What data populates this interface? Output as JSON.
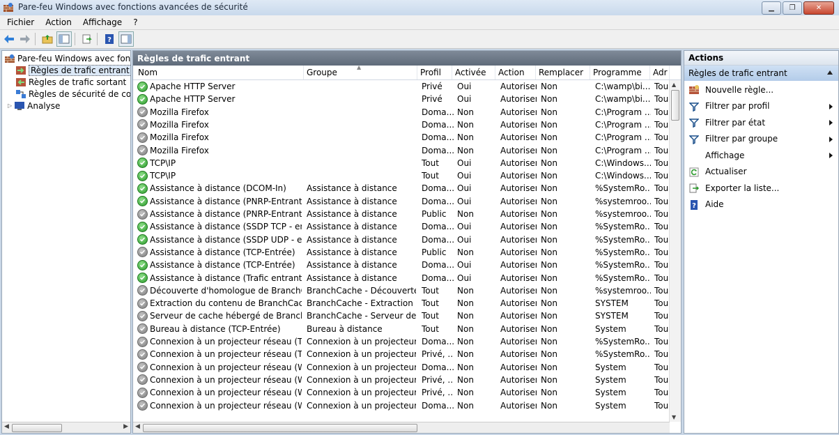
{
  "window": {
    "title": "Pare-feu Windows avec fonctions avancées de sécurité"
  },
  "menu": [
    "Fichier",
    "Action",
    "Affichage",
    "?"
  ],
  "tree": {
    "root": "Pare-feu Windows avec fonctio",
    "items": [
      "Règles de trafic entrant",
      "Règles de trafic sortant",
      "Règles de sécurité de conne",
      "Analyse"
    ]
  },
  "center": {
    "header": "Règles de trafic entrant",
    "columns": [
      "Nom",
      "Groupe",
      "Profil",
      "Activée",
      "Action",
      "Remplacer",
      "Programme",
      "Adr"
    ],
    "rows": [
      {
        "on": true,
        "nom": "Apache HTTP Server",
        "groupe": "",
        "profil": "Privé",
        "activee": "Oui",
        "action": "Autoriser",
        "remplacer": "Non",
        "programme": "C:\\wamp\\bi...",
        "adr": "Tou"
      },
      {
        "on": true,
        "nom": "Apache HTTP Server",
        "groupe": "",
        "profil": "Privé",
        "activee": "Oui",
        "action": "Autoriser",
        "remplacer": "Non",
        "programme": "C:\\wamp\\bi...",
        "adr": "Tou"
      },
      {
        "on": false,
        "nom": "Mozilla Firefox",
        "groupe": "",
        "profil": "Doma...",
        "activee": "Non",
        "action": "Autoriser",
        "remplacer": "Non",
        "programme": "C:\\Program ...",
        "adr": "Tou"
      },
      {
        "on": false,
        "nom": "Mozilla Firefox",
        "groupe": "",
        "profil": "Doma...",
        "activee": "Non",
        "action": "Autoriser",
        "remplacer": "Non",
        "programme": "C:\\Program ...",
        "adr": "Tou"
      },
      {
        "on": false,
        "nom": "Mozilla Firefox",
        "groupe": "",
        "profil": "Doma...",
        "activee": "Non",
        "action": "Autoriser",
        "remplacer": "Non",
        "programme": "C:\\Program ...",
        "adr": "Tou"
      },
      {
        "on": false,
        "nom": "Mozilla Firefox",
        "groupe": "",
        "profil": "Doma...",
        "activee": "Non",
        "action": "Autoriser",
        "remplacer": "Non",
        "programme": "C:\\Program ...",
        "adr": "Tou"
      },
      {
        "on": true,
        "nom": "TCP\\IP",
        "groupe": "",
        "profil": "Tout",
        "activee": "Oui",
        "action": "Autoriser",
        "remplacer": "Non",
        "programme": "C:\\Windows...",
        "adr": "Tou"
      },
      {
        "on": true,
        "nom": "TCP\\IP",
        "groupe": "",
        "profil": "Tout",
        "activee": "Oui",
        "action": "Autoriser",
        "remplacer": "Non",
        "programme": "C:\\Windows...",
        "adr": "Tou"
      },
      {
        "on": true,
        "nom": "Assistance à distance (DCOM-In)",
        "groupe": "Assistance à distance",
        "profil": "Doma...",
        "activee": "Oui",
        "action": "Autoriser",
        "remplacer": "Non",
        "programme": "%SystemRo...",
        "adr": "Tou"
      },
      {
        "on": true,
        "nom": "Assistance à distance (PNRP-Entrant)",
        "groupe": "Assistance à distance",
        "profil": "Doma...",
        "activee": "Oui",
        "action": "Autoriser",
        "remplacer": "Non",
        "programme": "%systemroo...",
        "adr": "Tou"
      },
      {
        "on": false,
        "nom": "Assistance à distance (PNRP-Entrant)",
        "groupe": "Assistance à distance",
        "profil": "Public",
        "activee": "Non",
        "action": "Autoriser",
        "remplacer": "Non",
        "programme": "%systemroo...",
        "adr": "Tou"
      },
      {
        "on": true,
        "nom": "Assistance à distance (SSDP TCP - en ent...",
        "groupe": "Assistance à distance",
        "profil": "Doma...",
        "activee": "Oui",
        "action": "Autoriser",
        "remplacer": "Non",
        "programme": "%SystemRo...",
        "adr": "Tou"
      },
      {
        "on": true,
        "nom": "Assistance à distance (SSDP UDP - en ent...",
        "groupe": "Assistance à distance",
        "profil": "Doma...",
        "activee": "Oui",
        "action": "Autoriser",
        "remplacer": "Non",
        "programme": "%SystemRo...",
        "adr": "Tou"
      },
      {
        "on": false,
        "nom": "Assistance à distance (TCP-Entrée)",
        "groupe": "Assistance à distance",
        "profil": "Public",
        "activee": "Non",
        "action": "Autoriser",
        "remplacer": "Non",
        "programme": "%SystemRo...",
        "adr": "Tou"
      },
      {
        "on": true,
        "nom": "Assistance à distance (TCP-Entrée)",
        "groupe": "Assistance à distance",
        "profil": "Doma...",
        "activee": "Oui",
        "action": "Autoriser",
        "remplacer": "Non",
        "programme": "%SystemRo...",
        "adr": "Tou"
      },
      {
        "on": true,
        "nom": "Assistance à distance (Trafic entrant TCP ...",
        "groupe": "Assistance à distance",
        "profil": "Doma...",
        "activee": "Oui",
        "action": "Autoriser",
        "remplacer": "Non",
        "programme": "%SystemRo...",
        "adr": "Tou"
      },
      {
        "on": false,
        "nom": "Découverte d'homologue de BranchCa...",
        "groupe": "BranchCache - Découverte ...",
        "profil": "Tout",
        "activee": "Non",
        "action": "Autoriser",
        "remplacer": "Non",
        "programme": "%systemroo...",
        "adr": "Tou"
      },
      {
        "on": false,
        "nom": "Extraction du contenu de BranchCache (...",
        "groupe": "BranchCache - Extraction d...",
        "profil": "Tout",
        "activee": "Non",
        "action": "Autoriser",
        "remplacer": "Non",
        "programme": "SYSTEM",
        "adr": "Tou"
      },
      {
        "on": false,
        "nom": "Serveur de cache hébergé de BranchCac...",
        "groupe": "BranchCache - Serveur de c...",
        "profil": "Tout",
        "activee": "Non",
        "action": "Autoriser",
        "remplacer": "Non",
        "programme": "SYSTEM",
        "adr": "Tou"
      },
      {
        "on": false,
        "nom": "Bureau à distance (TCP-Entrée)",
        "groupe": "Bureau à distance",
        "profil": "Tout",
        "activee": "Non",
        "action": "Autoriser",
        "remplacer": "Non",
        "programme": "System",
        "adr": "Tou"
      },
      {
        "on": false,
        "nom": "Connexion à un projecteur réseau (TCP-E...",
        "groupe": "Connexion à un projecteur r...",
        "profil": "Doma...",
        "activee": "Non",
        "action": "Autoriser",
        "remplacer": "Non",
        "programme": "%SystemRo...",
        "adr": "Tou"
      },
      {
        "on": false,
        "nom": "Connexion à un projecteur réseau (TCP-E...",
        "groupe": "Connexion à un projecteur r...",
        "profil": "Privé, ...",
        "activee": "Non",
        "action": "Autoriser",
        "remplacer": "Non",
        "programme": "%SystemRo...",
        "adr": "Tou"
      },
      {
        "on": false,
        "nom": "Connexion à un projecteur réseau (WSD ...",
        "groupe": "Connexion à un projecteur r...",
        "profil": "Doma...",
        "activee": "Non",
        "action": "Autoriser",
        "remplacer": "Non",
        "programme": "System",
        "adr": "Tou"
      },
      {
        "on": false,
        "nom": "Connexion à un projecteur réseau (WSD ...",
        "groupe": "Connexion à un projecteur r...",
        "profil": "Privé, ...",
        "activee": "Non",
        "action": "Autoriser",
        "remplacer": "Non",
        "programme": "System",
        "adr": "Tou"
      },
      {
        "on": false,
        "nom": "Connexion à un projecteur réseau (WSD ...",
        "groupe": "Connexion à un projecteur r...",
        "profil": "Privé, ...",
        "activee": "Non",
        "action": "Autoriser",
        "remplacer": "Non",
        "programme": "System",
        "adr": "Tou"
      },
      {
        "on": false,
        "nom": "Connexion à un projecteur réseau (WSD ...",
        "groupe": "Connexion à un projecteur r...",
        "profil": "Doma...",
        "activee": "Non",
        "action": "Autoriser",
        "remplacer": "Non",
        "programme": "System",
        "adr": "Tou"
      }
    ]
  },
  "actions": {
    "header": "Actions",
    "section": "Règles de trafic entrant",
    "items": [
      {
        "label": "Nouvelle règle...",
        "icon": "new-rule-icon",
        "submenu": false
      },
      {
        "label": "Filtrer par profil",
        "icon": "filter-icon",
        "submenu": true
      },
      {
        "label": "Filtrer par état",
        "icon": "filter-icon",
        "submenu": true
      },
      {
        "label": "Filtrer par groupe",
        "icon": "filter-icon",
        "submenu": true
      },
      {
        "label": "Affichage",
        "icon": "",
        "submenu": true
      },
      {
        "label": "Actualiser",
        "icon": "refresh-icon",
        "submenu": false
      },
      {
        "label": "Exporter la liste...",
        "icon": "export-icon",
        "submenu": false
      },
      {
        "label": "Aide",
        "icon": "help-icon",
        "submenu": false
      }
    ]
  },
  "colors": {
    "enabled": "#2a9a2a",
    "disabled": "#7c7c7c",
    "panel_header": "#66717f",
    "selection": "#b3cce9"
  }
}
